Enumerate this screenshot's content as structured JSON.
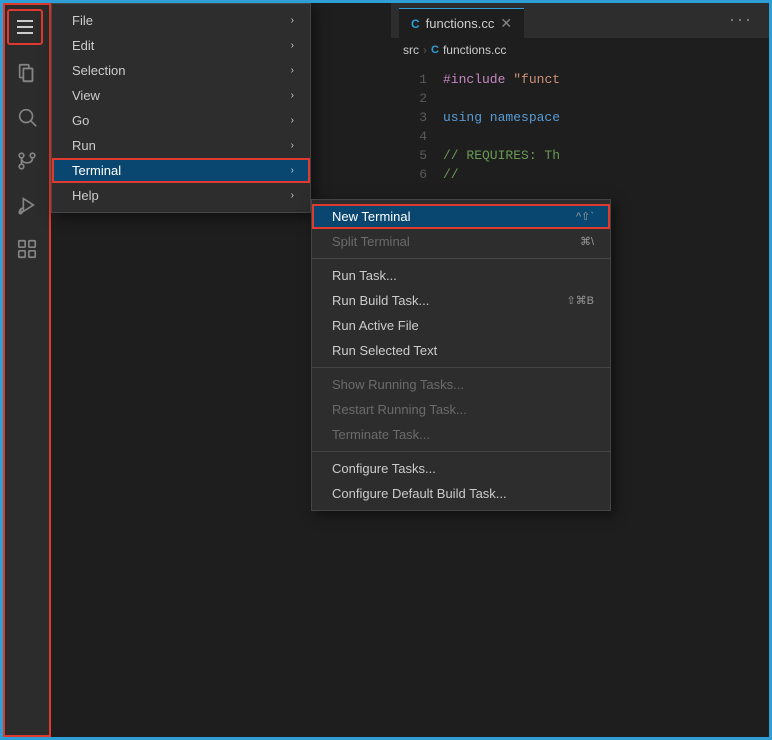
{
  "activityBar": {
    "icons": [
      {
        "name": "hamburger-icon",
        "label": "Menu"
      },
      {
        "name": "files-icon",
        "label": "Explorer"
      },
      {
        "name": "search-icon",
        "label": "Search"
      },
      {
        "name": "source-control-icon",
        "label": "Source Control"
      },
      {
        "name": "run-debug-icon",
        "label": "Run and Debug"
      },
      {
        "name": "extensions-icon",
        "label": "Extensions"
      }
    ]
  },
  "primaryMenu": {
    "items": [
      {
        "id": "file",
        "label": "File",
        "hasArrow": true
      },
      {
        "id": "edit",
        "label": "Edit",
        "hasArrow": true
      },
      {
        "id": "selection",
        "label": "Selection",
        "hasArrow": true
      },
      {
        "id": "view",
        "label": "View",
        "hasArrow": true
      },
      {
        "id": "go",
        "label": "Go",
        "hasArrow": true
      },
      {
        "id": "run",
        "label": "Run",
        "hasArrow": true
      },
      {
        "id": "terminal",
        "label": "Terminal",
        "hasArrow": true,
        "highlighted": true
      },
      {
        "id": "help",
        "label": "Help",
        "hasArrow": true
      }
    ]
  },
  "terminalSubmenu": {
    "items": [
      {
        "id": "new-terminal",
        "label": "New Terminal",
        "shortcut": "^⇧`",
        "highlighted": true,
        "disabled": false
      },
      {
        "id": "split-terminal",
        "label": "Split Terminal",
        "shortcut": "⌘\\",
        "highlighted": false,
        "disabled": true
      },
      {
        "id": "separator1",
        "type": "separator"
      },
      {
        "id": "run-task",
        "label": "Run Task...",
        "shortcut": "",
        "highlighted": false,
        "disabled": false
      },
      {
        "id": "run-build-task",
        "label": "Run Build Task...",
        "shortcut": "⇧⌘B",
        "highlighted": false,
        "disabled": false
      },
      {
        "id": "run-active-file",
        "label": "Run Active File",
        "shortcut": "",
        "highlighted": false,
        "disabled": false
      },
      {
        "id": "run-selected-text",
        "label": "Run Selected Text",
        "shortcut": "",
        "highlighted": false,
        "disabled": false
      },
      {
        "id": "separator2",
        "type": "separator"
      },
      {
        "id": "show-running-tasks",
        "label": "Show Running Tasks...",
        "shortcut": "",
        "highlighted": false,
        "disabled": true
      },
      {
        "id": "restart-running-task",
        "label": "Restart Running Task...",
        "shortcut": "",
        "highlighted": false,
        "disabled": true
      },
      {
        "id": "terminate-task",
        "label": "Terminate Task...",
        "shortcut": "",
        "highlighted": false,
        "disabled": true
      },
      {
        "id": "separator3",
        "type": "separator"
      },
      {
        "id": "configure-tasks",
        "label": "Configure Tasks...",
        "shortcut": "",
        "highlighted": false,
        "disabled": false
      },
      {
        "id": "configure-default-build",
        "label": "Configure Default Build Task...",
        "shortcut": "",
        "highlighted": false,
        "disabled": false
      }
    ]
  },
  "editor": {
    "tabs": [
      {
        "label": "functions.cc",
        "icon": "C+",
        "active": true
      }
    ],
    "breadcrumb": {
      "parts": [
        "src",
        "functions.cc"
      ]
    },
    "lines": [
      {
        "num": "1",
        "tokens": [
          {
            "type": "include",
            "text": "#include \"funct"
          }
        ]
      },
      {
        "num": "2",
        "tokens": []
      },
      {
        "num": "3",
        "tokens": [
          {
            "type": "namespace",
            "text": "using namespace"
          }
        ]
      },
      {
        "num": "4",
        "tokens": []
      },
      {
        "num": "5",
        "tokens": [
          {
            "type": "comment",
            "text": "// REQUIRES: Th"
          }
        ]
      },
      {
        "num": "6",
        "tokens": [
          {
            "type": "comment",
            "text": "//"
          }
        ]
      }
    ]
  },
  "colors": {
    "highlight": "#e0392d",
    "accent": "#2e9ed6",
    "menuBg": "#2d2d2d",
    "editorBg": "#1e1e1e"
  }
}
